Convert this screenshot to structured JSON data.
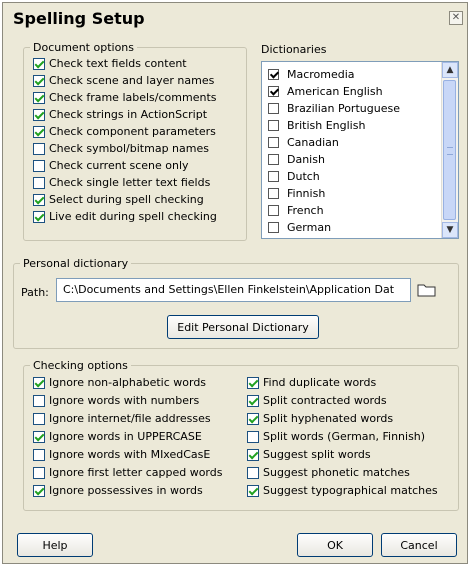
{
  "window": {
    "title": "Spelling Setup"
  },
  "document_options": {
    "legend": "Document options",
    "items": [
      {
        "label": "Check text fields content",
        "checked": true
      },
      {
        "label": "Check scene and layer names",
        "checked": true
      },
      {
        "label": "Check frame labels/comments",
        "checked": true
      },
      {
        "label": "Check strings in ActionScript",
        "checked": true
      },
      {
        "label": "Check component parameters",
        "checked": true
      },
      {
        "label": "Check symbol/bitmap names",
        "checked": false
      },
      {
        "label": "Check current scene only",
        "checked": false
      },
      {
        "label": "Check single letter text fields",
        "checked": false
      },
      {
        "label": "Select during spell checking",
        "checked": true
      },
      {
        "label": "Live edit during spell checking",
        "checked": true
      }
    ]
  },
  "dictionaries": {
    "label": "Dictionaries",
    "items": [
      {
        "label": "Macromedia",
        "checked": true
      },
      {
        "label": "American English",
        "checked": true
      },
      {
        "label": "Brazilian Portuguese",
        "checked": false
      },
      {
        "label": "British English",
        "checked": false
      },
      {
        "label": "Canadian",
        "checked": false
      },
      {
        "label": "Danish",
        "checked": false
      },
      {
        "label": "Dutch",
        "checked": false
      },
      {
        "label": "Finnish",
        "checked": false
      },
      {
        "label": "French",
        "checked": false
      },
      {
        "label": "German",
        "checked": false
      }
    ]
  },
  "personal_dictionary": {
    "legend": "Personal dictionary",
    "path_label": "Path:",
    "path_value": "C:\\Documents and Settings\\Ellen Finkelstein\\Application Dat",
    "edit_button": "Edit Personal Dictionary"
  },
  "checking_options": {
    "legend": "Checking options",
    "left": [
      {
        "label": "Ignore non-alphabetic words",
        "checked": true
      },
      {
        "label": "Ignore words with numbers",
        "checked": false
      },
      {
        "label": "Ignore internet/file addresses",
        "checked": false
      },
      {
        "label": "Ignore words in UPPERCASE",
        "checked": true
      },
      {
        "label": "Ignore words with MIxedCasE",
        "checked": false
      },
      {
        "label": "Ignore first letter capped words",
        "checked": false
      },
      {
        "label": "Ignore possessives in words",
        "checked": true
      }
    ],
    "right": [
      {
        "label": "Find duplicate words",
        "checked": true
      },
      {
        "label": "Split contracted words",
        "checked": true
      },
      {
        "label": "Split hyphenated words",
        "checked": true
      },
      {
        "label": "Split words (German, Finnish)",
        "checked": false
      },
      {
        "label": "Suggest split words",
        "checked": true
      },
      {
        "label": "Suggest phonetic matches",
        "checked": false
      },
      {
        "label": "Suggest typographical matches",
        "checked": true
      }
    ]
  },
  "buttons": {
    "help": "Help",
    "ok": "OK",
    "cancel": "Cancel"
  },
  "icons": {
    "close": "close-icon",
    "folder": "folder-icon",
    "scroll_up": "chevron-up-icon",
    "scroll_down": "chevron-down-icon"
  }
}
